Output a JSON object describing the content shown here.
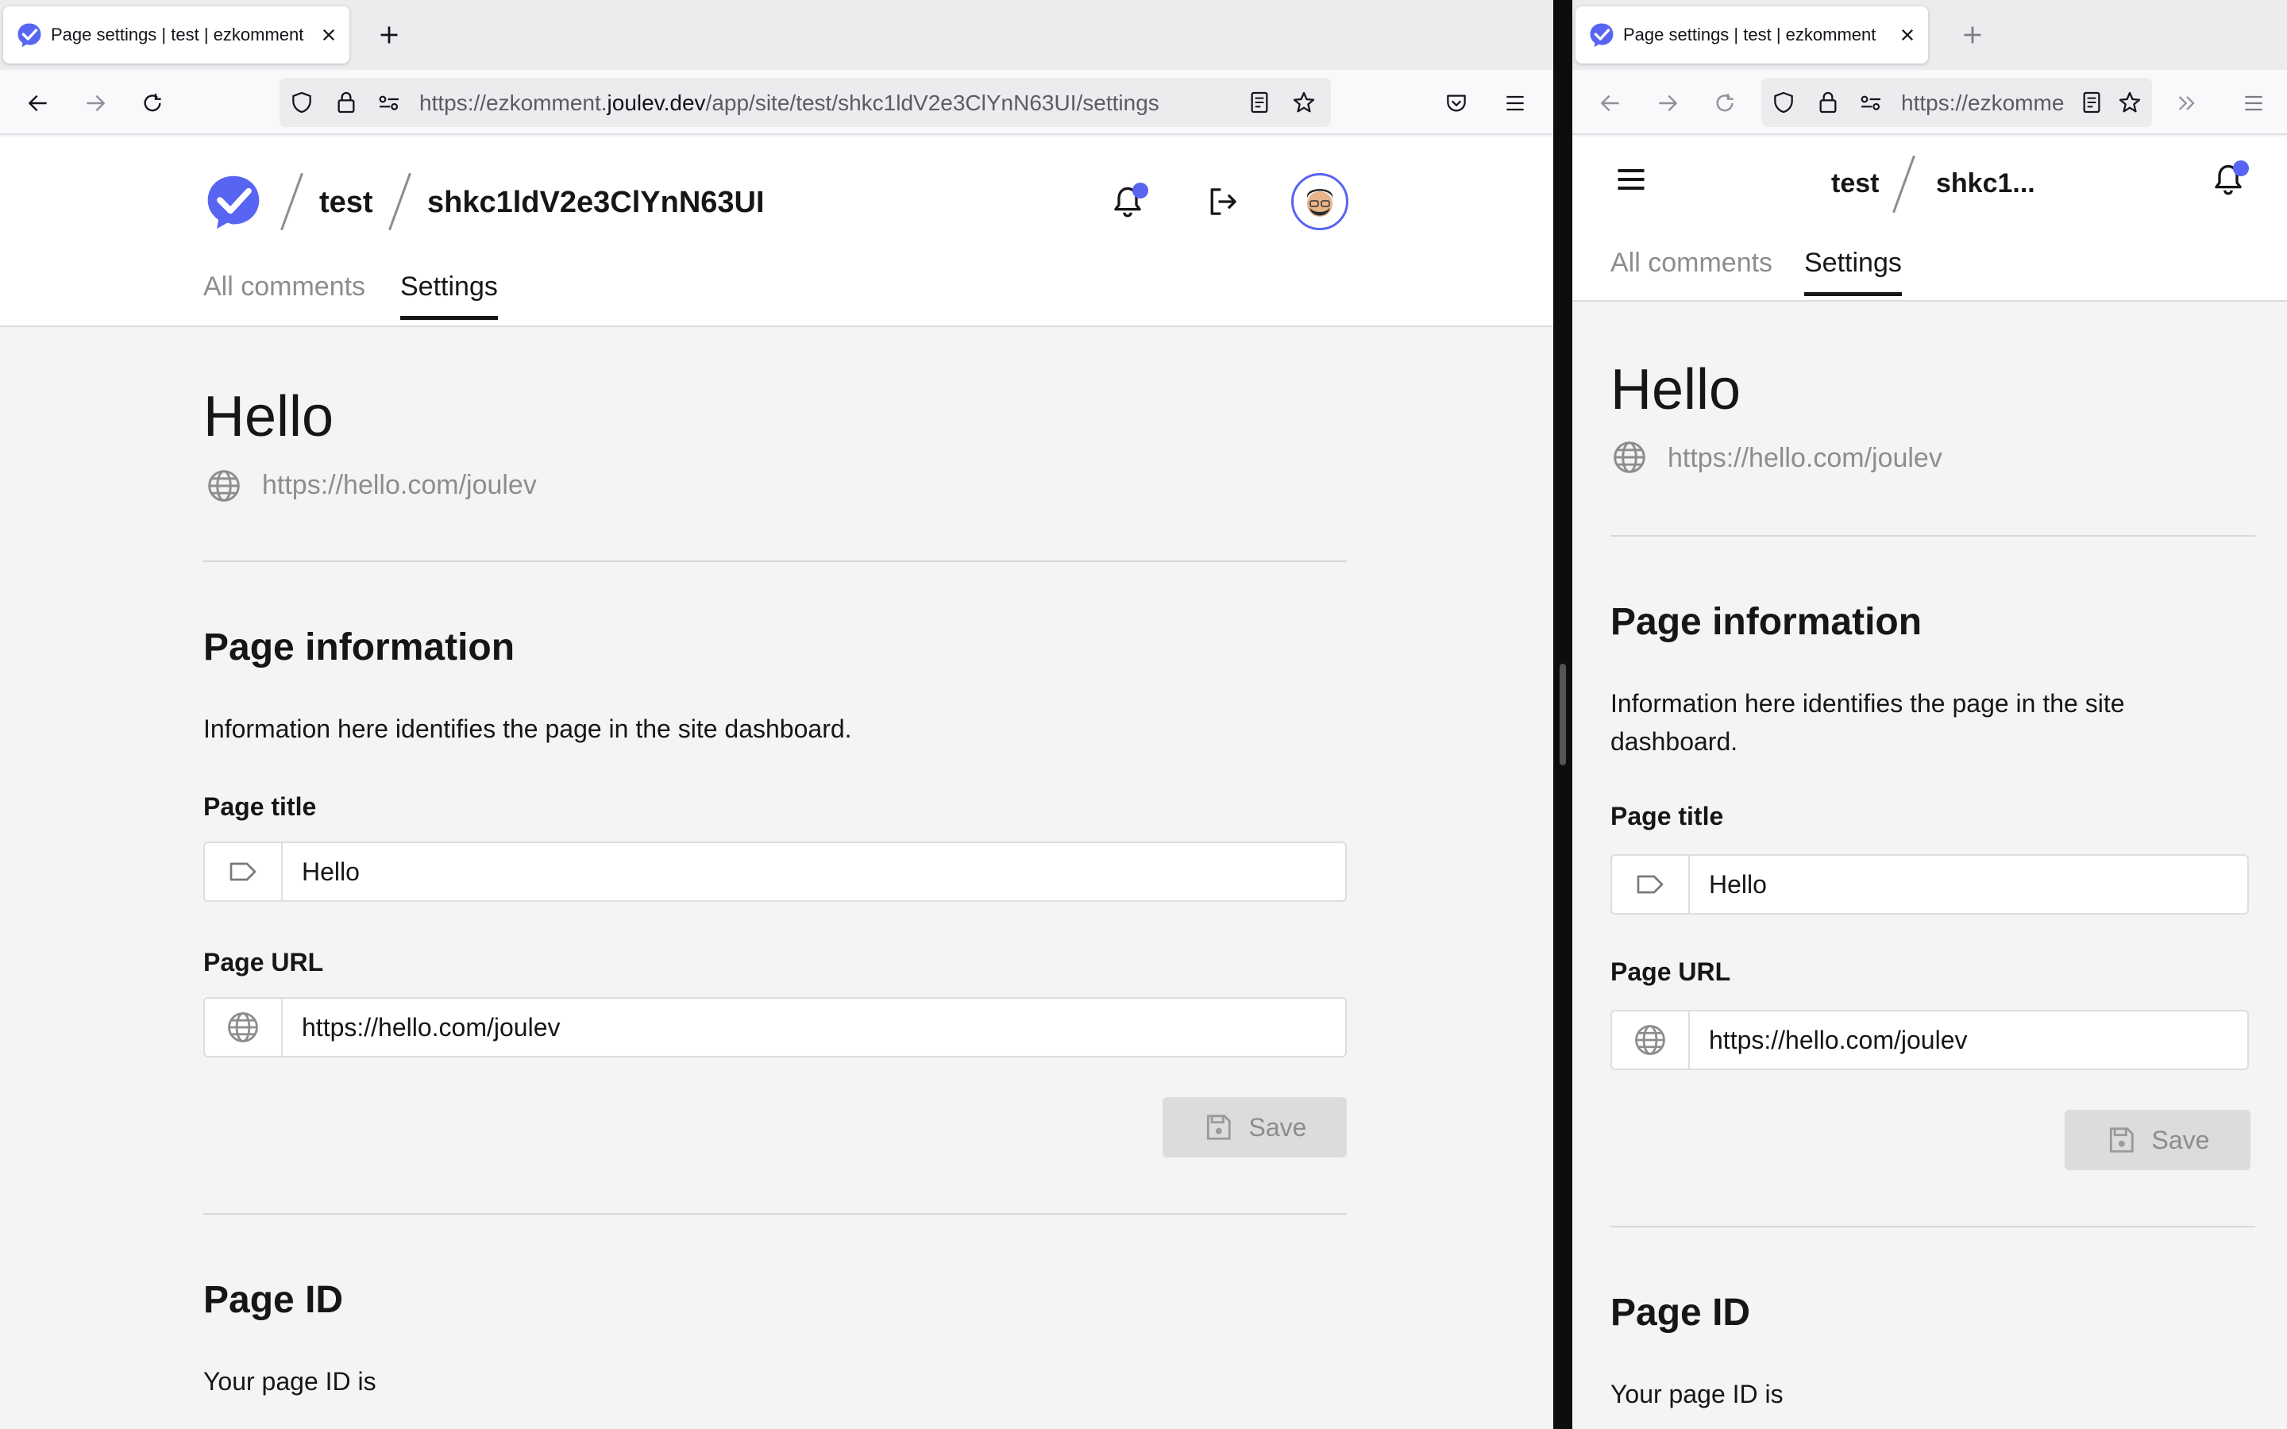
{
  "browser": {
    "tab_title": "Page settings | test | ezkomment",
    "url_prefix": "https://ezkomment.",
    "url_host": "joulev.dev",
    "url_path": "/app/site/test/shkc1ldV2e3ClYnN63UI/settings",
    "url_truncated": "https://ezkomme"
  },
  "app": {
    "site_name": "test",
    "page_id": "shkc1ldV2e3ClYnN63UI",
    "page_id_short": "shkc1...",
    "tabs": {
      "all_comments": "All comments",
      "settings": "Settings"
    },
    "accent_color": "#5865f2"
  },
  "page": {
    "title": "Hello",
    "url": "https://hello.com/joulev",
    "info_heading": "Page information",
    "info_text": "Information here identifies the page in the site dashboard.",
    "title_label": "Page title",
    "title_value": "Hello",
    "url_label": "Page URL",
    "url_value": "https://hello.com/joulev",
    "save_label": "Save",
    "id_heading": "Page ID",
    "id_text": "Your page ID is"
  }
}
